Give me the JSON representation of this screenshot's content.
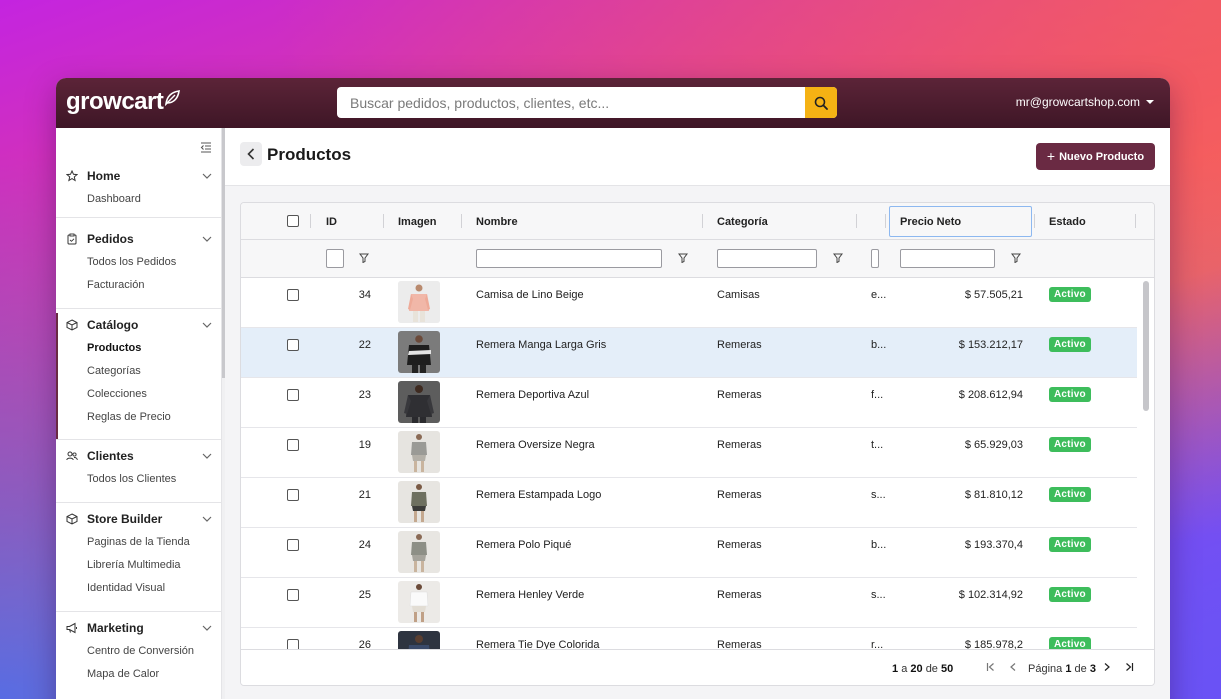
{
  "app": {
    "brand": "growcart",
    "search_placeholder": "Buscar pedidos, productos, clientes, etc...",
    "user_email": "mr@growcartshop.com"
  },
  "sidebar": {
    "sections": [
      {
        "label": "Home",
        "icon": "star-icon",
        "items": [
          "Dashboard"
        ]
      },
      {
        "label": "Pedidos",
        "icon": "clipboard-icon",
        "items": [
          "Todos los Pedidos",
          "Facturación"
        ]
      },
      {
        "label": "Catálogo",
        "icon": "box-icon",
        "items": [
          "Productos",
          "Categorías",
          "Colecciones",
          "Reglas de Precio"
        ]
      },
      {
        "label": "Clientes",
        "icon": "users-icon",
        "items": [
          "Todos los Clientes"
        ]
      },
      {
        "label": "Store Builder",
        "icon": "cube-icon",
        "items": [
          "Paginas de la Tienda",
          "Librería Multimedia",
          "Identidad Visual"
        ]
      },
      {
        "label": "Marketing",
        "icon": "megaphone-icon",
        "items": [
          "Centro de Conversión",
          "Mapa de Calor"
        ]
      }
    ],
    "active_item": "Productos"
  },
  "page": {
    "title": "Productos",
    "new_button": "Nuevo Producto",
    "new_button_plus": "+"
  },
  "table": {
    "columns": {
      "id": "ID",
      "image": "Imagen",
      "name": "Nombre",
      "category": "Categoría",
      "price": "Precio Neto",
      "status": "Estado"
    },
    "rows": [
      {
        "id": "34",
        "name": "Camisa de Lino Beige",
        "category": "Camisas",
        "desc": "e...",
        "price": "$ 57.505,21",
        "status": "Activo"
      },
      {
        "id": "22",
        "name": "Remera Manga Larga Gris",
        "category": "Remeras",
        "desc": "b...",
        "price": "$ 153.212,17",
        "status": "Activo"
      },
      {
        "id": "23",
        "name": "Remera Deportiva Azul",
        "category": "Remeras",
        "desc": "f...",
        "price": "$ 208.612,94",
        "status": "Activo"
      },
      {
        "id": "19",
        "name": "Remera Oversize Negra",
        "category": "Remeras",
        "desc": "t...",
        "price": "$ 65.929,03",
        "status": "Activo"
      },
      {
        "id": "21",
        "name": "Remera Estampada Logo",
        "category": "Remeras",
        "desc": "s...",
        "price": "$ 81.810,12",
        "status": "Activo"
      },
      {
        "id": "24",
        "name": "Remera Polo Piqué",
        "category": "Remeras",
        "desc": "b...",
        "price": "$ 193.370,4",
        "status": "Activo"
      },
      {
        "id": "25",
        "name": "Remera Henley Verde",
        "category": "Remeras",
        "desc": "s...",
        "price": "$ 102.314,92",
        "status": "Activo"
      },
      {
        "id": "26",
        "name": "Remera Tie Dye Colorida",
        "category": "Remeras",
        "desc": "r...",
        "price": "$ 185.978,2",
        "status": "Activo"
      }
    ],
    "selected_row_index": 1
  },
  "pagination": {
    "range_start": "1",
    "range_connector": "a",
    "range_end": "20",
    "of_word": "de",
    "total": "50",
    "page_word": "Página",
    "current_page": "1",
    "page_of_word": "de",
    "total_pages": "3"
  },
  "colors": {
    "topbar": "#4a1b2e",
    "accent": "#6a2a43",
    "search_button": "#f5b214",
    "status_active": "#3dbd5c",
    "selected_row": "#e4eef9"
  }
}
